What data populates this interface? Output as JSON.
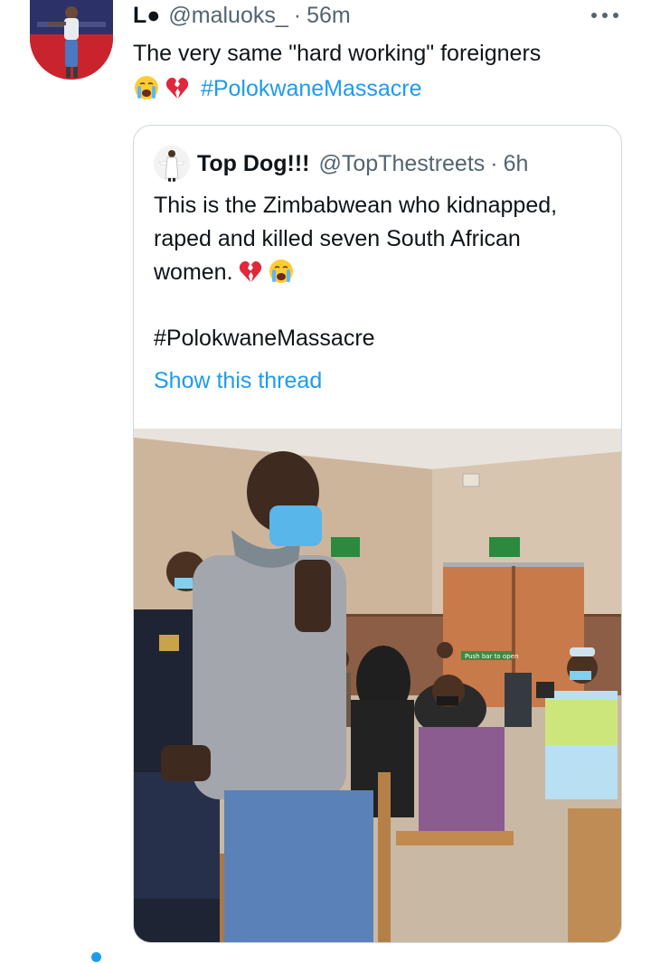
{
  "tweet": {
    "display_name": "L●",
    "handle": "@maluoks_",
    "separator": "·",
    "time": "56m",
    "text": "The very same \"hard working\"  foreigners",
    "hashtag": "#PolokwaneMassacre",
    "emojis": [
      "crying-face",
      "broken-heart"
    ],
    "more_icon": "more-horizontal-icon"
  },
  "quote": {
    "display_name": "Top Dog!!!",
    "handle": "@TopThestreets",
    "separator": "·",
    "time": "6h",
    "text": "This is the Zimbabwean who kidnapped, raped and killed seven South African women.",
    "emojis": [
      "broken-heart",
      "crying-face"
    ],
    "hashtag": "#PolokwaneMassacre",
    "show_thread": "Show this thread",
    "photo_sign_text": "Push bar to open"
  },
  "colors": {
    "accent": "#1d9bf0",
    "secondary_text": "#536471",
    "border": "#cfd9de"
  }
}
